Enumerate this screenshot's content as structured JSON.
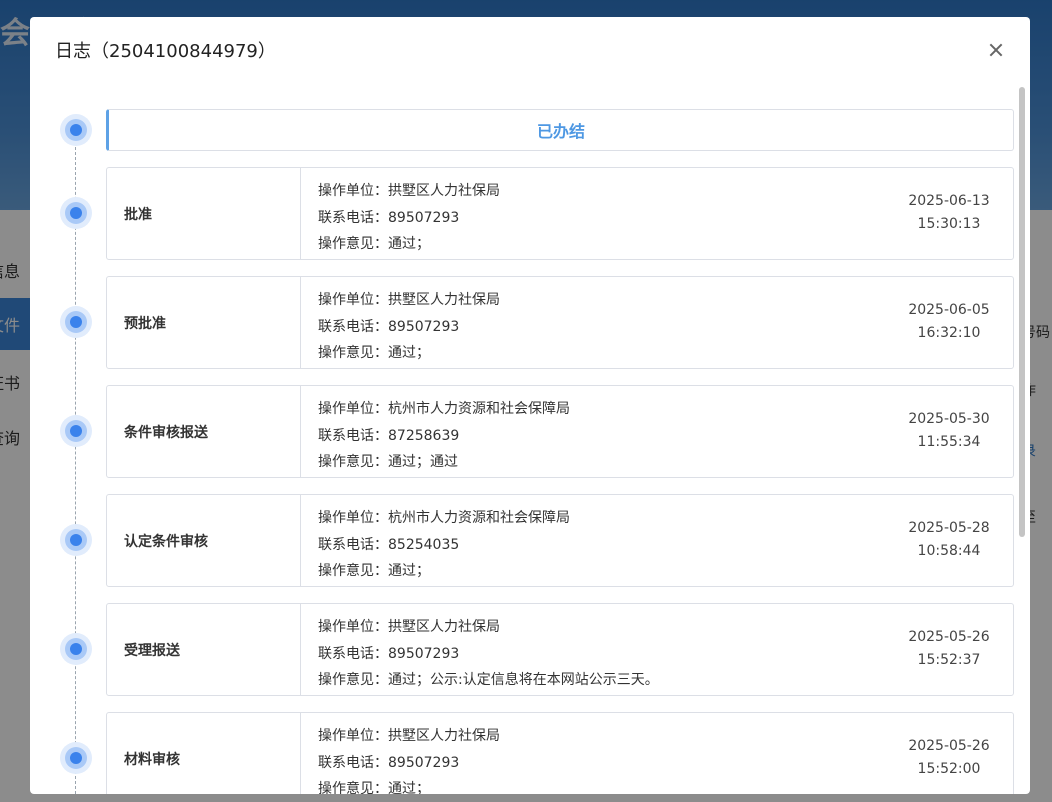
{
  "background": {
    "site_title": "会保障局",
    "sidebar": [
      {
        "label": "信息",
        "active": false
      },
      {
        "label": "文件",
        "active": true
      },
      {
        "label": "证书",
        "active": false
      },
      {
        "label": "查询",
        "active": false
      }
    ],
    "right_fragments": [
      "号码",
      "作",
      "录",
      "至"
    ]
  },
  "modal": {
    "title": "日志（2504100844979）",
    "status": "已办结",
    "labels": {
      "unit": "操作单位：",
      "phone": "联系电话：",
      "opinion": "操作意见："
    },
    "entries": [
      {
        "step": "批准",
        "unit": "拱墅区人力社保局",
        "phone": "89507293",
        "opinion": "通过；",
        "date": "2025-06-13",
        "time": "15:30:13"
      },
      {
        "step": "预批准",
        "unit": "拱墅区人力社保局",
        "phone": "89507293",
        "opinion": "通过；",
        "date": "2025-06-05",
        "time": "16:32:10"
      },
      {
        "step": "条件审核报送",
        "unit": "杭州市人力资源和社会保障局",
        "phone": "87258639",
        "opinion": "通过；通过",
        "date": "2025-05-30",
        "time": "11:55:34"
      },
      {
        "step": "认定条件审核",
        "unit": "杭州市人力资源和社会保障局",
        "phone": "85254035",
        "opinion": "通过；",
        "date": "2025-05-28",
        "time": "10:58:44"
      },
      {
        "step": "受理报送",
        "unit": "拱墅区人力社保局",
        "phone": "89507293",
        "opinion": "通过；公示:认定信息将在本网站公示三天。",
        "date": "2025-05-26",
        "time": "15:52:37"
      },
      {
        "step": "材料审核",
        "unit": "拱墅区人力社保局",
        "phone": "89507293",
        "opinion": "通过；",
        "date": "2025-05-26",
        "time": "15:52:00"
      }
    ]
  }
}
